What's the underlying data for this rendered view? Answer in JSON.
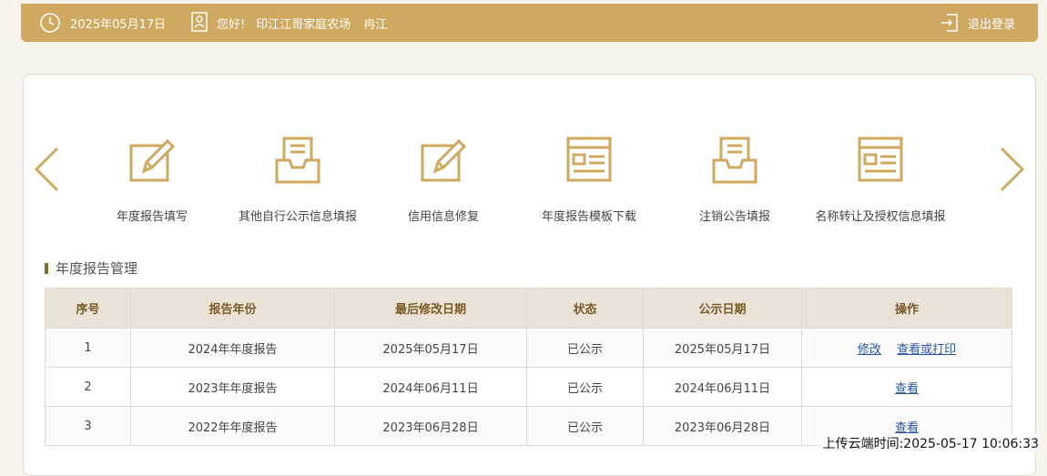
{
  "header": {
    "date": "2025年05月17日",
    "greeting": "您好!",
    "company": "印江江哥家庭农场",
    "user": "冉江",
    "logout_label": "退出登录",
    "bg_color": "#cfa95f"
  },
  "tiles": [
    {
      "label": "年度报告填写",
      "icon": "edit-form-icon"
    },
    {
      "label": "其他自行公示信息填报",
      "icon": "inbox-tray-icon"
    },
    {
      "label": "信用信息修复",
      "icon": "edit-form-icon"
    },
    {
      "label": "年度报告模板下载",
      "icon": "template-window-icon"
    },
    {
      "label": "注销公告填报",
      "icon": "inbox-tray-icon"
    },
    {
      "label": "名称转让及授权信息填报",
      "icon": "template-window-icon"
    }
  ],
  "section": {
    "title": "年度报告管理"
  },
  "table": {
    "headers": [
      "序号",
      "报告年份",
      "最后修改日期",
      "状态",
      "公示日期",
      "操作"
    ],
    "rows": [
      {
        "no": "1",
        "year": "2024年年度报告",
        "modified": "2025年05月17日",
        "status": "已公示",
        "published": "2025年05月17日",
        "action_edit": "修改",
        "action_view": "查看或打印"
      },
      {
        "no": "2",
        "year": "2023年年度报告",
        "modified": "2024年06月11日",
        "status": "已公示",
        "published": "2024年06月11日",
        "action_view": "查看"
      },
      {
        "no": "3",
        "year": "2022年年度报告",
        "modified": "2023年06月28日",
        "status": "已公示",
        "published": "2023年06月28日",
        "action_view": "查看"
      }
    ]
  },
  "upload_time": "上传云端时间:2025-05-17 10:06:33",
  "colors": {
    "accent": "#cfa95f",
    "link": "#2a57a8",
    "table_header": "#ebe3d7"
  }
}
